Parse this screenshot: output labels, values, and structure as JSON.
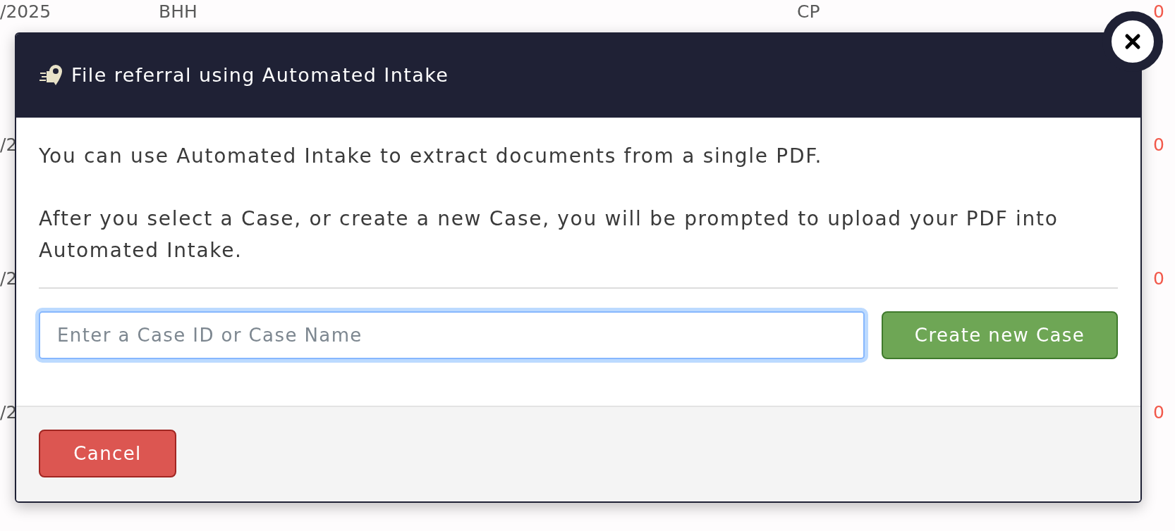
{
  "background_rows": [
    {
      "column_1": "/2025",
      "column_2": "BHH",
      "column_3": "CP",
      "column_4": "0"
    },
    {
      "column_1": "/2",
      "column_4": "0"
    },
    {
      "column_1": "/2",
      "column_4": "0"
    },
    {
      "column_1": "/2",
      "column_4": "0"
    }
  ],
  "modal": {
    "title": "File referral using Automated Intake",
    "paragraphs": [
      "You can use Automated Intake to extract documents from a single PDF.",
      "After you select a Case, or create a new Case, you will be prompted to upload your PDF into Automated Intake."
    ],
    "case_field": {
      "placeholder": "Enter a Case ID or Case Name",
      "focused": true
    },
    "create_button": "Create new Case",
    "cancel_button": "Cancel"
  }
}
